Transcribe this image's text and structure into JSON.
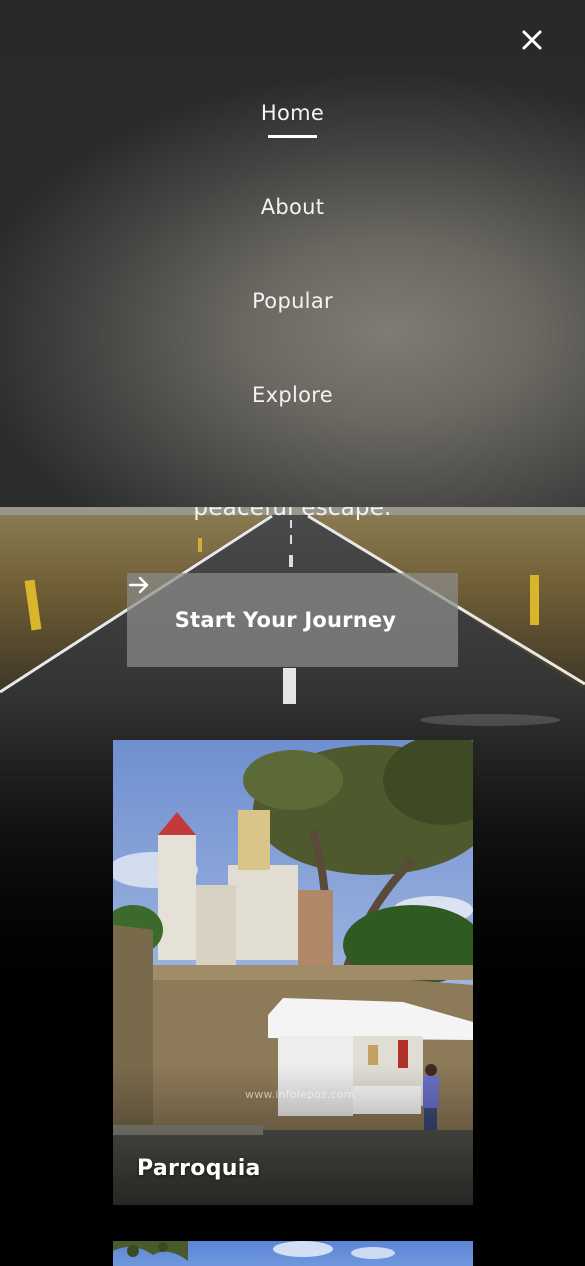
{
  "nav": {
    "close_icon": "close-icon",
    "items": [
      {
        "label": "Home",
        "active": true
      },
      {
        "label": "About",
        "active": false
      },
      {
        "label": "Popular",
        "active": false
      },
      {
        "label": "Explore",
        "active": false
      }
    ]
  },
  "hero": {
    "tagline_fragment": "peaceful escape.",
    "cta_label": "Start Your Journey",
    "cta_icon": "arrow-right-icon"
  },
  "cards": [
    {
      "title": "Parroquia",
      "watermark": "www.infolepoz.com"
    },
    {
      "title": ""
    }
  ],
  "colors": {
    "overlay": "#3a3a3a",
    "cta_bg": "#8c8c8a",
    "text": "#ffffff",
    "page_bg": "#000000"
  }
}
